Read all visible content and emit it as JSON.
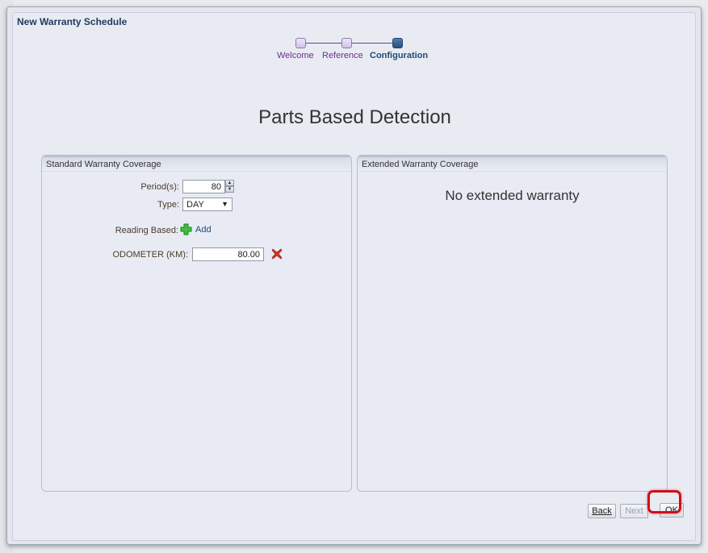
{
  "dialog": {
    "title": "New Warranty Schedule",
    "heading": "Parts Based Detection"
  },
  "train": {
    "steps": [
      {
        "label": "Welcome",
        "state": "visited"
      },
      {
        "label": "Reference",
        "state": "visited"
      },
      {
        "label": "Configuration",
        "state": "current"
      }
    ]
  },
  "standard": {
    "title": "Standard Warranty Coverage",
    "period_label": "Period(s):",
    "period_value": "80",
    "type_label": "Type:",
    "type_value": "DAY",
    "reading_label": "Reading Based:",
    "add_label": "Add",
    "odometer_label": "ODOMETER (KM):",
    "odometer_value": "80.00"
  },
  "extended": {
    "title": "Extended Warranty Coverage",
    "empty_message": "No extended warranty"
  },
  "footer": {
    "back_label": "Back",
    "next_label": "Next",
    "ok_label": "OK"
  },
  "colors": {
    "highlight": "#d10e16",
    "train_visited": "#6f2f8f",
    "train_current": "#1f4a72"
  }
}
